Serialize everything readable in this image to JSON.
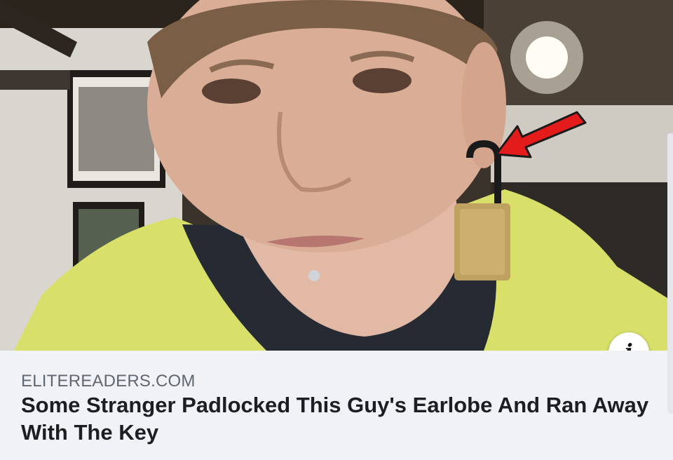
{
  "link_preview": {
    "source_domain": "ELITEREADERS.COM",
    "headline": "Some Stranger Padlocked This Guy's Earlobe And Ran Away With The Key",
    "info_glyph": "i"
  },
  "image": {
    "subject": "photo",
    "annotation_icon": "red-arrow-icon"
  },
  "colors": {
    "caption_bg": "#f0f2f5",
    "source_text": "#606770",
    "headline_text": "#1c1e21",
    "arrow": "#e31b1b",
    "hoodie": "#d8e06a"
  }
}
